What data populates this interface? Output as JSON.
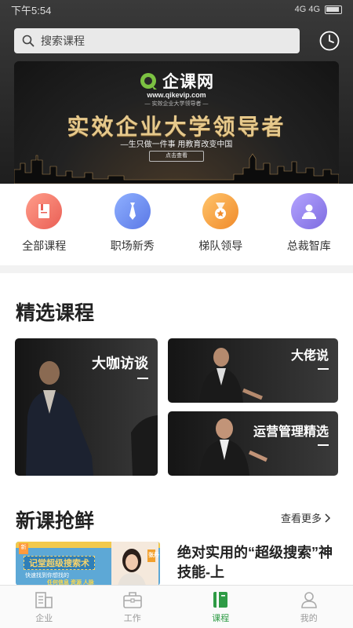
{
  "status_bar": {
    "time": "下午5:54",
    "network": "4G 4G",
    "battery": ""
  },
  "search": {
    "placeholder": "搜索课程"
  },
  "banner": {
    "logo_text": "企课网",
    "url": "www.qikevip.com",
    "small_tagline": "— 实效企业大学领导者 —",
    "headline": "实效企业大学领导者",
    "slogan": "—生只做一件事 用教育改变中国",
    "cta": "点击查看"
  },
  "categories": [
    {
      "label": "全部课程",
      "icon": "book-icon",
      "color": "#f07a6a"
    },
    {
      "label": "职场新秀",
      "icon": "tie-icon",
      "color": "#6f8ff0"
    },
    {
      "label": "梯队领导",
      "icon": "medal-icon",
      "color": "#f4a03a"
    },
    {
      "label": "总裁智库",
      "icon": "executive-icon",
      "color": "#8f7ce6"
    }
  ],
  "featured": {
    "title": "精选课程",
    "cards": [
      {
        "title": "大咖访谈"
      },
      {
        "title": "大佬说"
      },
      {
        "title": "运营管理精选"
      }
    ]
  },
  "new_courses": {
    "title": "新课抢鲜",
    "more": "查看更多",
    "items": [
      {
        "title": "绝对实用的“超级搜索”神技能-上",
        "thumb_title": "记堂超级搜索术",
        "thumb_sub1": "快速找到你想找的",
        "thumb_sub2": "任何信息 资源 人脉",
        "thumb_tag": "新",
        "thumb_badge": "张丹"
      }
    ]
  },
  "tabbar": {
    "items": [
      {
        "label": "企业",
        "icon": "building-icon",
        "active": false
      },
      {
        "label": "工作",
        "icon": "briefcase-icon",
        "active": false
      },
      {
        "label": "课程",
        "icon": "course-book-icon",
        "active": true
      },
      {
        "label": "我的",
        "icon": "person-icon",
        "active": false
      }
    ]
  },
  "colors": {
    "accent": "#2e9b45",
    "header_bg": "#2a2a2a",
    "gold": "#e6c98c"
  }
}
